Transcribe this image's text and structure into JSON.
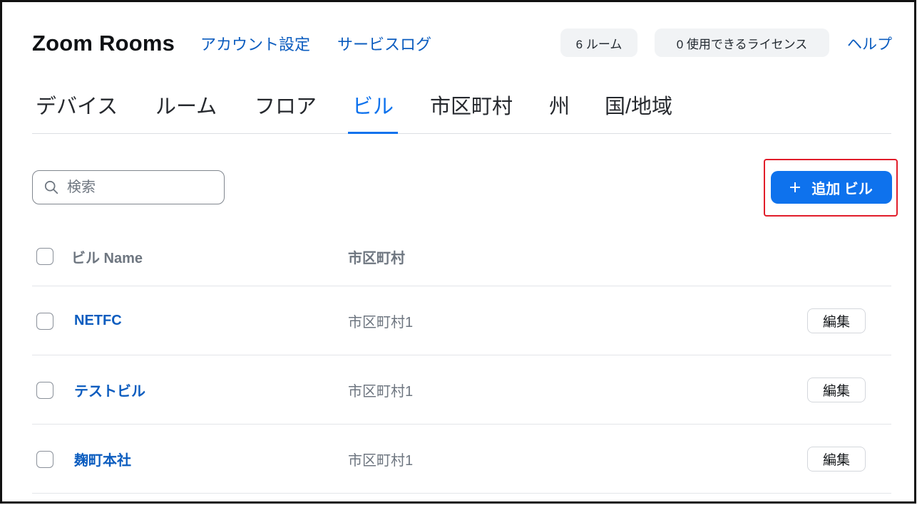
{
  "header": {
    "title": "Zoom Rooms",
    "account_settings": "アカウント設定",
    "service_log": "サービスログ",
    "rooms_count": "6 ルーム",
    "licenses": "0 使用できるライセンス",
    "help": "ヘルプ"
  },
  "tabs": [
    {
      "label": "デバイス",
      "active": false
    },
    {
      "label": "ルーム",
      "active": false
    },
    {
      "label": "フロア",
      "active": false
    },
    {
      "label": "ビル",
      "active": true
    },
    {
      "label": "市区町村",
      "active": false
    },
    {
      "label": "州",
      "active": false
    },
    {
      "label": "国/地域",
      "active": false
    }
  ],
  "search": {
    "placeholder": "検索",
    "icon": "search-icon"
  },
  "add_button": {
    "icon": "plus-icon",
    "label": "追加 ビル"
  },
  "table": {
    "columns": [
      "ビル Name",
      "市区町村"
    ],
    "rows": [
      {
        "name": "NETFC",
        "city": "市区町村1",
        "action": "編集"
      },
      {
        "name": "テストビル",
        "city": "市区町村1",
        "action": "編集"
      },
      {
        "name": "麹町本社",
        "city": "市区町村1",
        "action": "編集"
      }
    ]
  },
  "colors": {
    "accent": "#0e72ed",
    "link": "#0b5cbf",
    "muted": "#6e7680",
    "text": "#131619",
    "highlight": "#e11d2a",
    "pill": "#f1f3f5",
    "divider": "#e3e5e9"
  }
}
